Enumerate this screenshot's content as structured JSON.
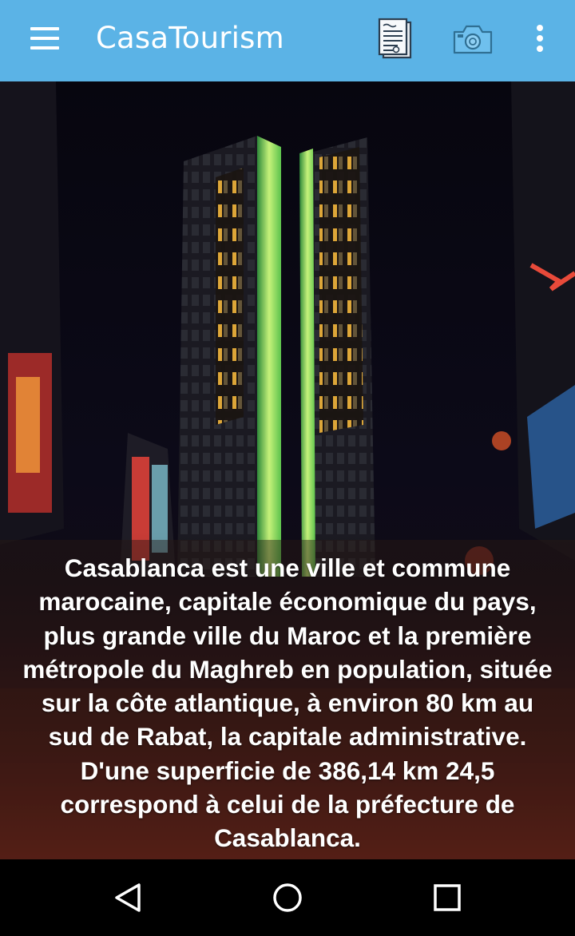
{
  "app_bar": {
    "title": "CasaTourism",
    "background_color": "#5bb3e6",
    "icons": [
      "menu-icon",
      "document-icon",
      "camera-icon",
      "more-vert-icon"
    ]
  },
  "hero": {
    "image": "night-towers-photo"
  },
  "caption": {
    "lines": [
      "Casablanca est une ville et commune",
      "marocaine, capitale économique du pays,",
      "plus grande ville du Maroc et la première",
      "métropole du Maghreb en population, située",
      "sur la côte atlantique, à environ 80 km au",
      "sud de Rabat, la capitale administrative.",
      "D'une superficie de 386,14 km 24,5",
      "correspond à celui de la préfecture de",
      "Casablanca."
    ]
  },
  "navigation_bar": {
    "icons": [
      "back-icon",
      "home-icon",
      "recents-icon"
    ]
  }
}
